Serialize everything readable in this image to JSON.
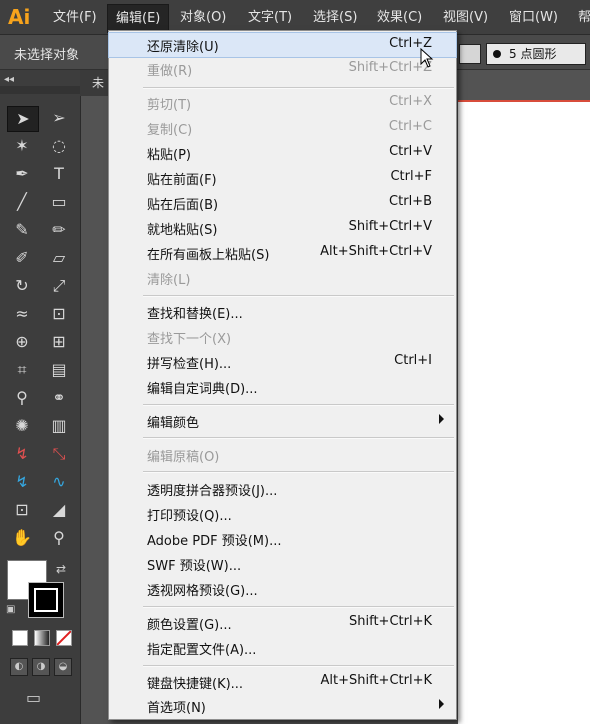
{
  "app": {
    "logo": "Ai"
  },
  "menubar": {
    "items": [
      {
        "label": "文件(F)"
      },
      {
        "label": "编辑(E)"
      },
      {
        "label": "对象(O)"
      },
      {
        "label": "文字(T)"
      },
      {
        "label": "选择(S)"
      },
      {
        "label": "效果(C)"
      },
      {
        "label": "视图(V)"
      },
      {
        "label": "窗口(W)"
      },
      {
        "label": "帮"
      }
    ]
  },
  "controlbar": {
    "selection_status": "未选择对象",
    "brush_value": "5 点圆形"
  },
  "document": {
    "tab_label": "未"
  },
  "edit_menu": {
    "items": [
      {
        "label": "还原清除(U)",
        "shortcut": "Ctrl+Z",
        "enabled": true
      },
      {
        "label": "重做(R)",
        "shortcut": "Shift+Ctrl+Z",
        "enabled": false
      },
      {
        "label": "剪切(T)",
        "shortcut": "Ctrl+X",
        "enabled": false
      },
      {
        "label": "复制(C)",
        "shortcut": "Ctrl+C",
        "enabled": false
      },
      {
        "label": "粘贴(P)",
        "shortcut": "Ctrl+V",
        "enabled": true
      },
      {
        "label": "贴在前面(F)",
        "shortcut": "Ctrl+F",
        "enabled": true
      },
      {
        "label": "贴在后面(B)",
        "shortcut": "Ctrl+B",
        "enabled": true
      },
      {
        "label": "就地粘贴(S)",
        "shortcut": "Shift+Ctrl+V",
        "enabled": true
      },
      {
        "label": "在所有画板上粘贴(S)",
        "shortcut": "Alt+Shift+Ctrl+V",
        "enabled": true
      },
      {
        "label": "清除(L)",
        "shortcut": "",
        "enabled": false
      },
      {
        "label": "查找和替换(E)...",
        "shortcut": "",
        "enabled": true
      },
      {
        "label": "查找下一个(X)",
        "shortcut": "",
        "enabled": false
      },
      {
        "label": "拼写检查(H)...",
        "shortcut": "Ctrl+I",
        "enabled": true
      },
      {
        "label": "编辑自定词典(D)...",
        "shortcut": "",
        "enabled": true
      },
      {
        "label": "编辑颜色",
        "shortcut": "",
        "enabled": true,
        "submenu": true
      },
      {
        "label": "编辑原稿(O)",
        "shortcut": "",
        "enabled": false
      },
      {
        "label": "透明度拼合器预设(J)...",
        "shortcut": "",
        "enabled": true
      },
      {
        "label": "打印预设(Q)...",
        "shortcut": "",
        "enabled": true
      },
      {
        "label": "Adobe PDF 预设(M)...",
        "shortcut": "",
        "enabled": true
      },
      {
        "label": "SWF 预设(W)...",
        "shortcut": "",
        "enabled": true
      },
      {
        "label": "透视网格预设(G)...",
        "shortcut": "",
        "enabled": true
      },
      {
        "label": "颜色设置(G)...",
        "shortcut": "Shift+Ctrl+K",
        "enabled": true
      },
      {
        "label": "指定配置文件(A)...",
        "shortcut": "",
        "enabled": true
      },
      {
        "label": "键盘快捷键(K)...",
        "shortcut": "Alt+Shift+Ctrl+K",
        "enabled": true
      },
      {
        "label": "首选项(N)",
        "shortcut": "",
        "enabled": true,
        "submenu": true
      }
    ]
  }
}
